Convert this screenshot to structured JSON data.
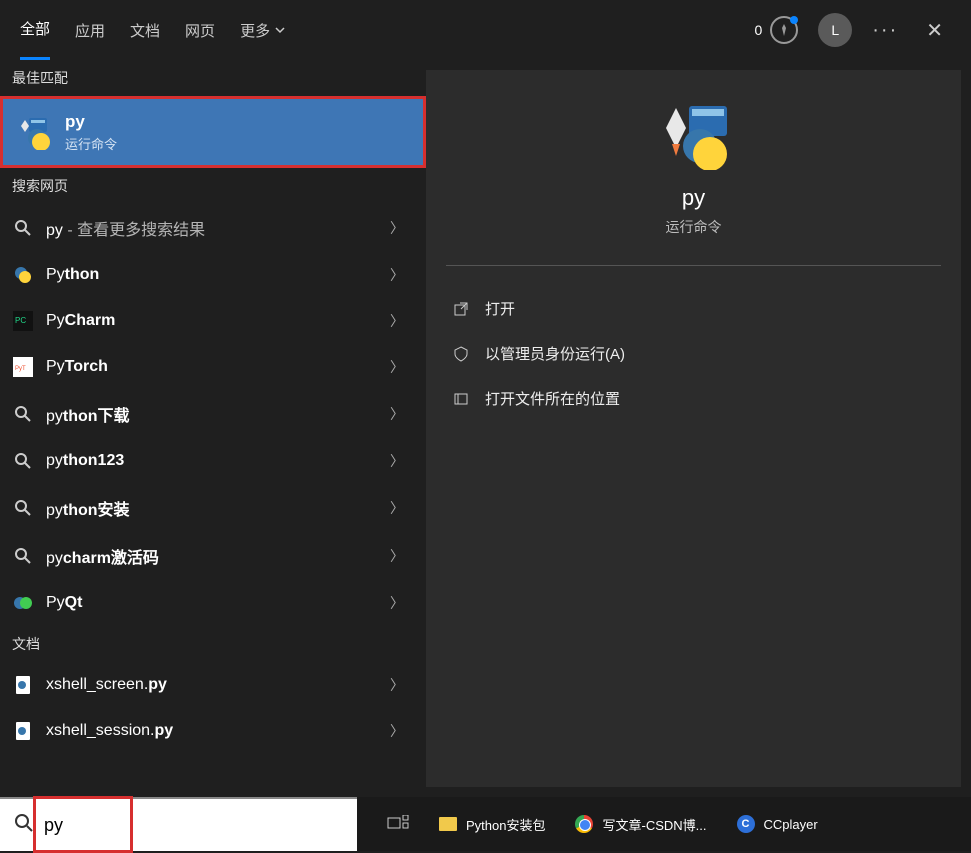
{
  "header": {
    "tabs": {
      "all": "全部",
      "apps": "应用",
      "docs": "文档",
      "web": "网页",
      "more": "更多"
    },
    "rewards_count": "0",
    "user_initial": "L"
  },
  "left": {
    "best_match_header": "最佳匹配",
    "best_match": {
      "title": "py",
      "subtitle": "运行命令"
    },
    "web_header": "搜索网页",
    "items": [
      {
        "prefix": "py",
        "suffix": " - 查看更多搜索结果",
        "icon": "search"
      },
      {
        "prefix": "Py",
        "bold": "thon",
        "icon": "python"
      },
      {
        "prefix": "Py",
        "bold": "Charm",
        "icon": "pycharm"
      },
      {
        "prefix": "Py",
        "bold": "Torch",
        "icon": "pytorch"
      },
      {
        "prefix": "py",
        "bold": "thon下载",
        "icon": "search"
      },
      {
        "prefix": "py",
        "bold": "thon123",
        "icon": "search"
      },
      {
        "prefix": "py",
        "bold": "thon安装",
        "icon": "search"
      },
      {
        "prefix": "py",
        "bold": "charm激活码",
        "icon": "search"
      },
      {
        "prefix": "Py",
        "bold": "Qt",
        "icon": "pyqt"
      }
    ],
    "docs_header": "文档",
    "docs": [
      {
        "name_prefix": "xshell_screen.",
        "name_bold": "py"
      },
      {
        "name_prefix": "xshell_session.",
        "name_bold": "py"
      }
    ]
  },
  "detail": {
    "title": "py",
    "subtitle": "运行命令",
    "actions": {
      "open": "打开",
      "admin": "以管理员身份运行(A)",
      "location": "打开文件所在的位置"
    }
  },
  "search": {
    "value": "py"
  },
  "taskbar": {
    "items": [
      {
        "label": "Python安装包",
        "icon": "folder"
      },
      {
        "label": "写文章-CSDN博...",
        "icon": "chrome"
      },
      {
        "label": "CCplayer",
        "icon": "ccplayer"
      }
    ]
  }
}
